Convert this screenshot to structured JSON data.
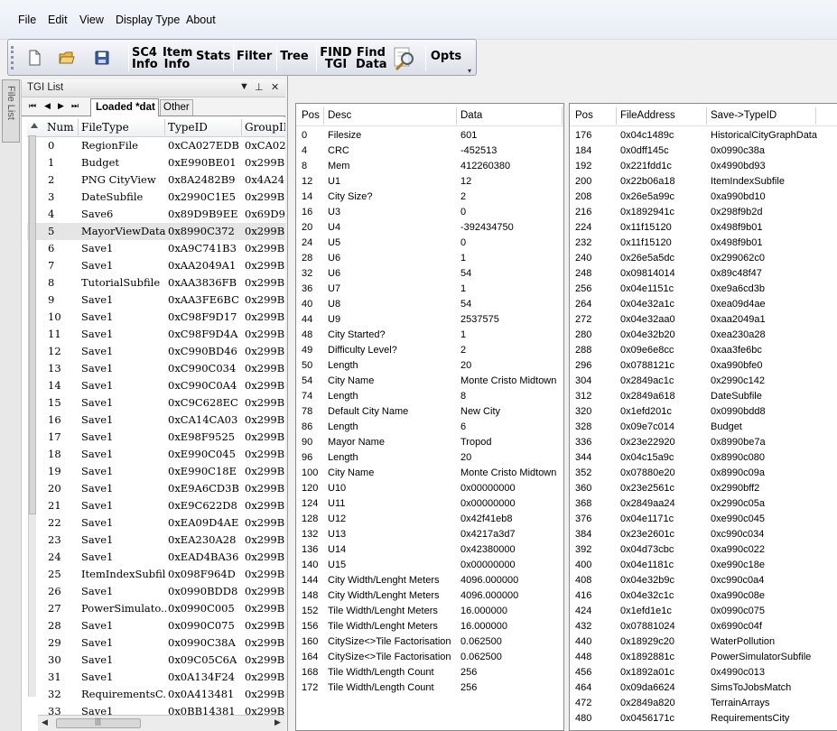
{
  "menu": [
    "File",
    "Edit",
    "View",
    "Display Type",
    "About"
  ],
  "toolbar": {
    "new_icon": "new-file-icon",
    "open_icon": "open-folder-icon",
    "save_icon": "save-disk-icon",
    "sc4info": "SC4\nInfo",
    "iteminfo": "Item\nInfo",
    "stats": "Stats",
    "filter": "Filter",
    "tree": "Tree",
    "findtgi": "FIND\nTGI",
    "finddata": "Find\nData",
    "search_icon": "magnifier-icon",
    "opts": "Opts"
  },
  "side_tab": "File List",
  "tgi_panel": {
    "title": "TGI List",
    "tabs": [
      "Loaded *dat",
      "Other"
    ],
    "columns": [
      "Num",
      "FileType",
      "TypeID",
      "GroupII"
    ],
    "rows": [
      [
        "0",
        "RegionFile",
        "0xCA027EDB",
        "0xCA02"
      ],
      [
        "1",
        "Budget",
        "0xE990BE01",
        "0x299B2"
      ],
      [
        "2",
        "PNG CityView",
        "0x8A2482B9",
        "0x4A24"
      ],
      [
        "3",
        "DateSubfile",
        "0x2990C1E5",
        "0x299B2"
      ],
      [
        "4",
        "Save6",
        "0x89D9B9EE",
        "0x69D9"
      ],
      [
        "5",
        "MayorViewData",
        "0x8990C372",
        "0x299B2"
      ],
      [
        "6",
        "Save1",
        "0xA9C741B3",
        "0x299B2"
      ],
      [
        "7",
        "Save1",
        "0xAA2049A1",
        "0x299B2"
      ],
      [
        "8",
        "TutorialSubfile",
        "0xAA3836FB",
        "0x299B2"
      ],
      [
        "9",
        "Save1",
        "0xAA3FE6BC",
        "0x299B2"
      ],
      [
        "10",
        "Save1",
        "0xC98F9D17",
        "0x299B2"
      ],
      [
        "11",
        "Save1",
        "0xC98F9D4A",
        "0x299B2"
      ],
      [
        "12",
        "Save1",
        "0xC990BD46",
        "0x299B2"
      ],
      [
        "13",
        "Save1",
        "0xC990C034",
        "0x299B2"
      ],
      [
        "14",
        "Save1",
        "0xC990C0A4",
        "0x299B2"
      ],
      [
        "15",
        "Save1",
        "0xC9C628EC",
        "0x299B2"
      ],
      [
        "16",
        "Save1",
        "0xCA14CA03",
        "0x299B2"
      ],
      [
        "17",
        "Save1",
        "0xE98F9525",
        "0x299B2"
      ],
      [
        "18",
        "Save1",
        "0xE990C045",
        "0x299B2"
      ],
      [
        "19",
        "Save1",
        "0xE990C18E",
        "0x299B2"
      ],
      [
        "20",
        "Save1",
        "0xE9A6CD3B",
        "0x299B2"
      ],
      [
        "21",
        "Save1",
        "0xE9C622D8",
        "0x299B2"
      ],
      [
        "22",
        "Save1",
        "0xEA09D4AE",
        "0x299B2"
      ],
      [
        "23",
        "Save1",
        "0xEA230A28",
        "0x299B2"
      ],
      [
        "24",
        "Save1",
        "0xEAD4BA36",
        "0x299B2"
      ],
      [
        "25",
        "ItemIndexSubfile",
        "0x098F964D",
        "0x299B2"
      ],
      [
        "26",
        "Save1",
        "0x0990BDD8",
        "0x299B2"
      ],
      [
        "27",
        "PowerSimulato...",
        "0x0990C005",
        "0x299B2"
      ],
      [
        "28",
        "Save1",
        "0x0990C075",
        "0x299B2"
      ],
      [
        "29",
        "Save1",
        "0x0990C38A",
        "0x299B2"
      ],
      [
        "30",
        "Save1",
        "0x09C05C6A",
        "0x299B2"
      ],
      [
        "31",
        "Save1",
        "0x0A134F24",
        "0x299B2"
      ],
      [
        "32",
        "RequirementsC...",
        "0x0A413481",
        "0x299B2"
      ],
      [
        "33",
        "Save1",
        "0x0BB14381",
        "0x299B2"
      ]
    ]
  },
  "desc_grid": {
    "columns": [
      "Pos",
      "Desc",
      "Data"
    ],
    "rows": [
      [
        "0",
        "Filesize",
        "601"
      ],
      [
        "4",
        "CRC",
        "-452513"
      ],
      [
        "8",
        "Mem",
        "412260380"
      ],
      [
        "12",
        "U1",
        "12"
      ],
      [
        "14",
        "City Size?",
        "2"
      ],
      [
        "16",
        "U3",
        "0"
      ],
      [
        "20",
        "U4",
        "-392434750"
      ],
      [
        "24",
        "U5",
        "0"
      ],
      [
        "28",
        "U6",
        "1"
      ],
      [
        "32",
        "U6",
        "54"
      ],
      [
        "36",
        "U7",
        "1"
      ],
      [
        "40",
        "U8",
        "54"
      ],
      [
        "44",
        "U9",
        "2537575"
      ],
      [
        "48",
        "City Started?",
        "1"
      ],
      [
        "49",
        "Difficulty Level?",
        "2"
      ],
      [
        "50",
        "Length",
        "20"
      ],
      [
        "54",
        "City Name",
        "Monte Cristo Midtown"
      ],
      [
        "74",
        "Length",
        "8"
      ],
      [
        "78",
        "Default City Name",
        "New City"
      ],
      [
        "86",
        "Length",
        "6"
      ],
      [
        "90",
        "Mayor Name",
        "Tropod"
      ],
      [
        "96",
        "Length",
        "20"
      ],
      [
        "100",
        "City Name",
        "Monte Cristo Midtown"
      ],
      [
        "120",
        "U10",
        "0x00000000"
      ],
      [
        "124",
        "U11",
        "0x00000000"
      ],
      [
        "128",
        "U12",
        "0x42f41eb8"
      ],
      [
        "132",
        "U13",
        "0x4217a3d7"
      ],
      [
        "136",
        "U14",
        "0x42380000"
      ],
      [
        "140",
        "U15",
        "0x00000000"
      ],
      [
        "144",
        "City Width/Lenght Meters",
        "4096.000000"
      ],
      [
        "148",
        "City Width/Lenght Meters",
        "4096.000000"
      ],
      [
        "152",
        "Tile Width/Lenght Meters",
        "16.000000"
      ],
      [
        "156",
        "Tile Width/Lenght Meters",
        "16.000000"
      ],
      [
        "160",
        "CitySize<>Tile Factorisation",
        "0.062500"
      ],
      [
        "164",
        "CitySize<>Tile Factorisation",
        "0.062500"
      ],
      [
        "168",
        "Tile Width/Length Count",
        "256"
      ],
      [
        "172",
        "Tile Width/Length Count",
        "256"
      ]
    ]
  },
  "addr_grid": {
    "columns": [
      "Pos",
      "FileAddress",
      "Save->TypeID"
    ],
    "rows": [
      [
        "176",
        "0x04c1489c",
        "HistoricalCityGraphData"
      ],
      [
        "184",
        "0x0dff145c",
        "0x0990c38a"
      ],
      [
        "192",
        "0x221fdd1c",
        "0x4990bd93"
      ],
      [
        "200",
        "0x22b06a18",
        "ItemIndexSubfile"
      ],
      [
        "208",
        "0x26e5a99c",
        "0xa990bd10"
      ],
      [
        "216",
        "0x1892941c",
        "0x298f9b2d"
      ],
      [
        "224",
        "0x11f15120",
        "0x498f9b01"
      ],
      [
        "232",
        "0x11f15120",
        "0x498f9b01"
      ],
      [
        "240",
        "0x26e5a5dc",
        "0x299062c0"
      ],
      [
        "248",
        "0x09814014",
        "0x89c48f47"
      ],
      [
        "256",
        "0x04e1151c",
        "0xe9a6cd3b"
      ],
      [
        "264",
        "0x04e32a1c",
        "0xea09d4ae"
      ],
      [
        "272",
        "0x04e32aa0",
        "0xaa2049a1"
      ],
      [
        "280",
        "0x04e32b20",
        "0xea230a28"
      ],
      [
        "288",
        "0x09e6e8cc",
        "0xaa3fe6bc"
      ],
      [
        "296",
        "0x0788121c",
        "0xa990bfe0"
      ],
      [
        "304",
        "0x2849ac1c",
        "0x2990c142"
      ],
      [
        "312",
        "0x2849a618",
        "DateSubfile"
      ],
      [
        "320",
        "0x1efd201c",
        "0x0990bdd8"
      ],
      [
        "328",
        "0x09e7c014",
        "Budget"
      ],
      [
        "336",
        "0x23e22920",
        "0x8990be7a"
      ],
      [
        "344",
        "0x04c15a9c",
        "0x8990c080"
      ],
      [
        "352",
        "0x07880e20",
        "0x8990c09a"
      ],
      [
        "360",
        "0x23e2561c",
        "0x2990bff2"
      ],
      [
        "368",
        "0x2849aa24",
        "0x2990c05a"
      ],
      [
        "376",
        "0x04e1171c",
        "0xe990c045"
      ],
      [
        "384",
        "0x23e2601c",
        "0xc990c034"
      ],
      [
        "392",
        "0x04d73cbc",
        "0xa990c022"
      ],
      [
        "400",
        "0x04e1181c",
        "0xe990c18e"
      ],
      [
        "408",
        "0x04e32b9c",
        "0xc990c0a4"
      ],
      [
        "416",
        "0x04e32c1c",
        "0xa990c08e"
      ],
      [
        "424",
        "0x1efd1e1c",
        "0x0990c075"
      ],
      [
        "432",
        "0x07881024",
        "0x6990c04f"
      ],
      [
        "440",
        "0x18929c20",
        "WaterPollution"
      ],
      [
        "448",
        "0x1892881c",
        "PowerSimulatorSubfile"
      ],
      [
        "456",
        "0x1892a01c",
        "0x4990c013"
      ],
      [
        "464",
        "0x09da6624",
        "SimsToJobsMatch"
      ],
      [
        "472",
        "0x2849a820",
        "TerrainArrays"
      ],
      [
        "480",
        "0x0456171c",
        "RequirementsCity"
      ]
    ]
  }
}
